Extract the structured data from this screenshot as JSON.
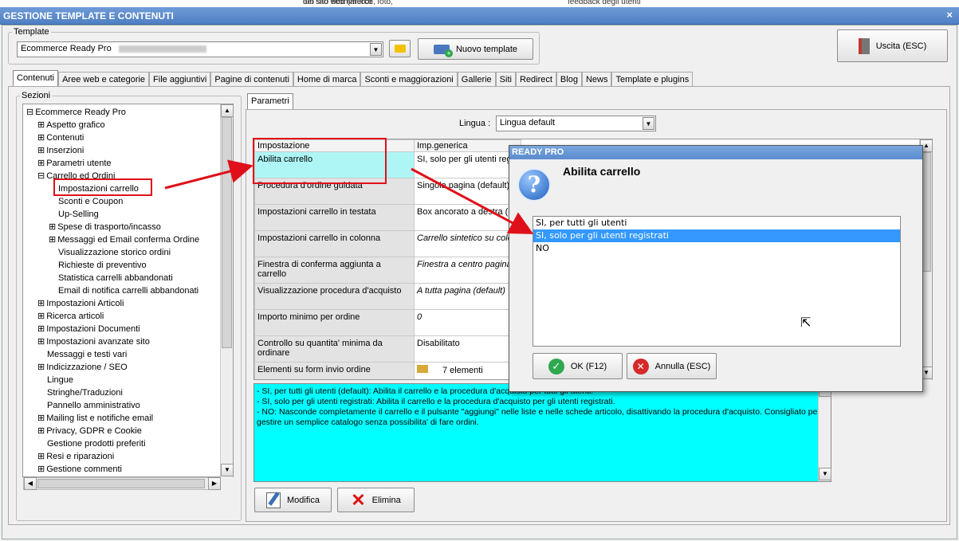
{
  "background_strip": {
    "t1": "dei sito web (articoli, foto,",
    "t2": "tuo sito ecommerce",
    "t3": "feedback degli utenti"
  },
  "window": {
    "title": "GESTIONE TEMPLATE E CONTENUTI",
    "close": "×"
  },
  "template_group": {
    "legend": "Template",
    "selected": "Ecommerce Ready Pro",
    "new_button": "Nuovo template"
  },
  "exit_button": "Uscita (ESC)",
  "tabs": [
    "Contenuti",
    "Aree web e categorie",
    "File aggiuntivi",
    "Pagine di contenuti",
    "Home di marca",
    "Sconti e maggiorazioni",
    "Gallerie",
    "Siti",
    "Redirect",
    "Blog",
    "News",
    "Template e plugins"
  ],
  "sections": {
    "legend": "Sezioni",
    "items": [
      {
        "label": "Ecommerce Ready Pro",
        "level": 0,
        "toggle": "⊟"
      },
      {
        "label": "Aspetto grafico",
        "level": 1,
        "toggle": "⊞"
      },
      {
        "label": "Contenuti",
        "level": 1,
        "toggle": "⊞"
      },
      {
        "label": "Inserzioni",
        "level": 1,
        "toggle": "⊞"
      },
      {
        "label": "Parametri utente",
        "level": 1,
        "toggle": "⊞"
      },
      {
        "label": "Carrello ed Ordini",
        "level": 1,
        "toggle": "⊟"
      },
      {
        "label": "Impostazioni carrello",
        "level": 2,
        "toggle": ""
      },
      {
        "label": "Sconti e Coupon",
        "level": 2,
        "toggle": ""
      },
      {
        "label": "Up-Selling",
        "level": 2,
        "toggle": ""
      },
      {
        "label": "Spese di trasporto/incasso",
        "level": 2,
        "toggle": "⊞"
      },
      {
        "label": "Messaggi ed Email conferma Ordine",
        "level": 2,
        "toggle": "⊞"
      },
      {
        "label": "Visualizzazione storico ordini",
        "level": 2,
        "toggle": ""
      },
      {
        "label": "Richieste di preventivo",
        "level": 2,
        "toggle": ""
      },
      {
        "label": "Statistica carrelli abbandonati",
        "level": 2,
        "toggle": ""
      },
      {
        "label": "Email di notifica carrelli abbandonati",
        "level": 2,
        "toggle": ""
      },
      {
        "label": "Impostazioni Articoli",
        "level": 1,
        "toggle": "⊞"
      },
      {
        "label": "Ricerca articoli",
        "level": 1,
        "toggle": "⊞"
      },
      {
        "label": "Impostazioni Documenti",
        "level": 1,
        "toggle": "⊞"
      },
      {
        "label": "Impostazioni avanzate sito",
        "level": 1,
        "toggle": "⊞"
      },
      {
        "label": "Messaggi e testi vari",
        "level": 1,
        "toggle": ""
      },
      {
        "label": "Indicizzazione / SEO",
        "level": 1,
        "toggle": "⊞"
      },
      {
        "label": "Lingue",
        "level": 1,
        "toggle": ""
      },
      {
        "label": "Stringhe/Traduzioni",
        "level": 1,
        "toggle": ""
      },
      {
        "label": "Pannello amministrativo",
        "level": 1,
        "toggle": ""
      },
      {
        "label": "Mailing list e notifiche email",
        "level": 1,
        "toggle": "⊞"
      },
      {
        "label": "Privacy, GDPR e Cookie",
        "level": 1,
        "toggle": "⊞"
      },
      {
        "label": "Gestione prodotti preferiti",
        "level": 1,
        "toggle": ""
      },
      {
        "label": "Resi e riparazioni",
        "level": 1,
        "toggle": "⊞"
      },
      {
        "label": "Gestione commenti",
        "level": 1,
        "toggle": "⊞"
      }
    ]
  },
  "params": {
    "tab": "Parametri",
    "lang_label": "Lingua :",
    "lang_value": "Lingua default",
    "col1": "Impostazione",
    "col2": "Imp.generica",
    "rows": [
      {
        "k": "Abilita carrello",
        "v": "SI, solo per gli utenti regis"
      },
      {
        "k": "Procedura d'ordine guidata",
        "v": "Singola pagina (default)"
      },
      {
        "k": "Impostazioni carrello in testata",
        "v": "Box ancorato a destra (d"
      },
      {
        "k": "Impostazioni carrello in colonna",
        "v": "Carrello sintetico su colo"
      },
      {
        "k": "Finestra di conferma aggiunta a carrello",
        "v": "Finestra a centro pagina"
      },
      {
        "k": "Visualizzazione procedura d'acquisto",
        "v": "A tutta pagina (default)"
      },
      {
        "k": "Importo minimo per ordine",
        "v": "0"
      },
      {
        "k": "Controllo su quantita' minima da ordinare",
        "v": "Disabilitato"
      },
      {
        "k": "Elementi su form invio ordine",
        "v": "7 elementi"
      }
    ],
    "description": [
      "- SI, per tutti gli utenti (default): Abilita il carrello e la procedura d'acquisto per tutti gli utenti.",
      "- SI, solo per gli utenti registrati: Abilita il carrello e la procedura d'acquisto per gli utenti registrati.",
      "- NO: Nasconde completamente il carrello e il pulsante \"aggiungi\" nelle liste e nelle schede articolo, disattivando la procedura d'acquisto. Consigliato per gestire un semplice catalogo senza possibilita' di fare ordini."
    ],
    "modify": "Modifica",
    "delete": "Elimina"
  },
  "dialog": {
    "title": "READY PRO",
    "heading": "Abilita carrello",
    "options": [
      "SI, per tutti gli utenti",
      "SI, solo per gli utenti registrati",
      "NO"
    ],
    "selected_index": 1,
    "ok": "OK (F12)",
    "cancel": "Annulla (ESC)"
  },
  "colors": {
    "highlight": "#00ffff",
    "selection": "#3399ff",
    "annotation": "#e0101a",
    "titlebar": "#4f7fc4"
  }
}
